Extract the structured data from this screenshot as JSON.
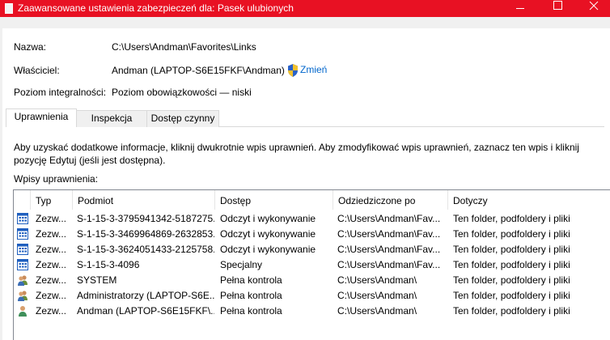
{
  "window": {
    "title": "Zaawansowane ustawienia zabezpieczeń dla: Pasek ulubionych"
  },
  "fields": {
    "name_label": "Nazwa:",
    "name_value": "C:\\Users\\Andman\\Favorites\\Links",
    "owner_label": "Właściciel:",
    "owner_value": "Andman (LAPTOP-S6E15FKF\\Andman)",
    "change_link": "Zmień",
    "integrity_label": "Poziom integralności:",
    "integrity_value": "Poziom obowiązkowości — niski"
  },
  "tabs": [
    "Uprawnienia",
    "Inspekcja",
    "Dostęp czynny"
  ],
  "info_text": "Aby uzyskać dodatkowe informacje, kliknij dwukrotnie wpis uprawnień. Aby zmodyfikować wpis uprawnień, zaznacz ten wpis i kliknij pozycję Edytuj (jeśli jest dostępna).",
  "entries_label": "Wpisy uprawnienia:",
  "table": {
    "columns": [
      "Typ",
      "Podmiot",
      "Dostęp",
      "Odziedziczone po",
      "Dotyczy"
    ],
    "rows": [
      {
        "icon": "app-package-icon",
        "type": "Zezw...",
        "principal": "S-1-15-3-3795941342-5187275...",
        "access": "Odczyt i wykonywanie",
        "inherited": "C:\\Users\\Andman\\Fav...",
        "applies": "Ten folder, podfoldery i pliki"
      },
      {
        "icon": "app-package-icon",
        "type": "Zezw...",
        "principal": "S-1-15-3-3469964869-2632853...",
        "access": "Odczyt i wykonywanie",
        "inherited": "C:\\Users\\Andman\\Fav...",
        "applies": "Ten folder, podfoldery i pliki"
      },
      {
        "icon": "app-package-icon",
        "type": "Zezw...",
        "principal": "S-1-15-3-3624051433-2125758...",
        "access": "Odczyt i wykonywanie",
        "inherited": "C:\\Users\\Andman\\Fav...",
        "applies": "Ten folder, podfoldery i pliki"
      },
      {
        "icon": "app-package-icon",
        "type": "Zezw...",
        "principal": "S-1-15-3-4096",
        "access": "Specjalny",
        "inherited": "C:\\Users\\Andman\\Fav...",
        "applies": "Ten folder, podfoldery i pliki"
      },
      {
        "icon": "users-group-icon",
        "type": "Zezw...",
        "principal": "SYSTEM",
        "access": "Pełna kontrola",
        "inherited": "C:\\Users\\Andman\\",
        "applies": "Ten folder, podfoldery i pliki"
      },
      {
        "icon": "users-group-icon",
        "type": "Zezw...",
        "principal": "Administratorzy (LAPTOP-S6E...",
        "access": "Pełna kontrola",
        "inherited": "C:\\Users\\Andman\\",
        "applies": "Ten folder, podfoldery i pliki"
      },
      {
        "icon": "user-icon",
        "type": "Zezw...",
        "principal": "Andman (LAPTOP-S6E15FKF\\...",
        "access": "Pełna kontrola",
        "inherited": "C:\\Users\\Andman\\",
        "applies": "Ten folder, podfoldery i pliki"
      }
    ]
  },
  "colors": {
    "titlebar": "#e81123",
    "link": "#0066cc"
  }
}
